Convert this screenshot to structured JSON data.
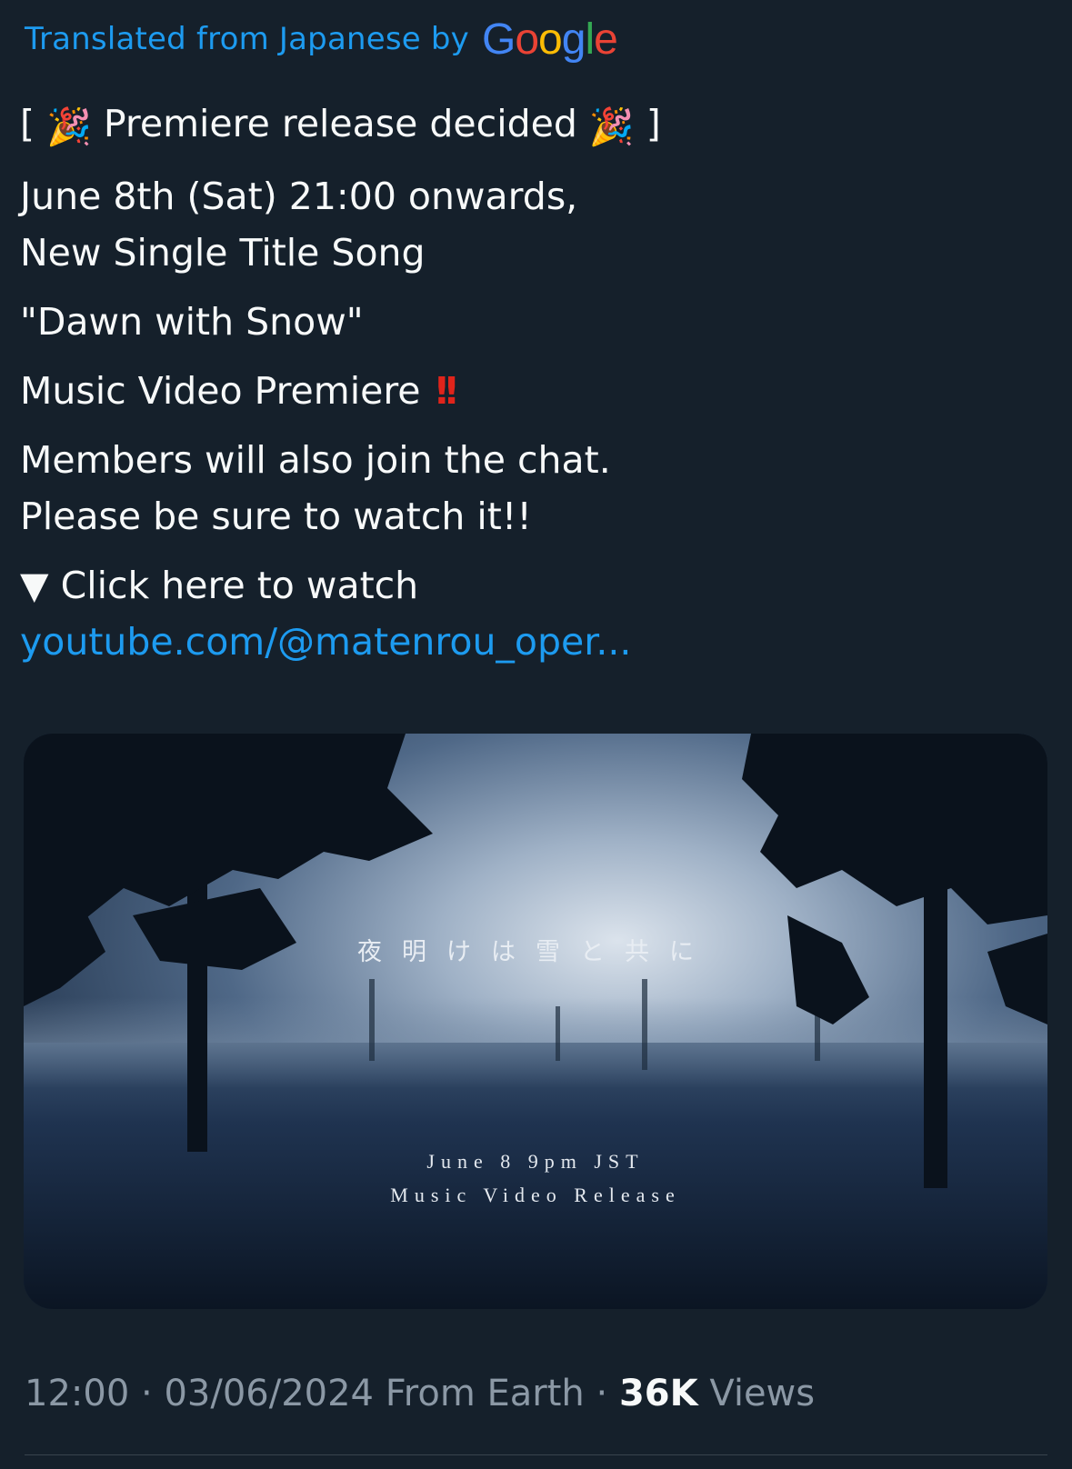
{
  "translation": {
    "label": "Translated from Japanese by",
    "brand": [
      "G",
      "o",
      "o",
      "g",
      "l",
      "e"
    ]
  },
  "tweet": {
    "line1_open": "[",
    "line1_text": "Premiere release decided",
    "line1_close": "]",
    "party_emoji": "🎉",
    "line2": "June 8th (Sat) 21:00 onwards,",
    "line3": "New Single Title Song",
    "line4": "\"Dawn with Snow\"",
    "line5": "Music Video Premiere",
    "line5_mark": "!!",
    "line6": "Members will also join the chat.",
    "line7": "Please be sure to watch it!!",
    "line8": "▼ Click here to watch",
    "link": "youtube.com/@matenrou_oper..."
  },
  "media": {
    "jp_title": "夜明けは雪と共に",
    "release_line1": "June 8  9pm JST",
    "release_line2": "Music Video Release"
  },
  "meta": {
    "time": "12:00",
    "separator": "·",
    "date": "03/06/2024",
    "source": "From Earth",
    "views_count": "36K",
    "views_label": "Views"
  },
  "colors": {
    "background": "#15202b",
    "link": "#1d9bf0",
    "muted": "#8b98a5",
    "text": "#f7f9f9"
  }
}
